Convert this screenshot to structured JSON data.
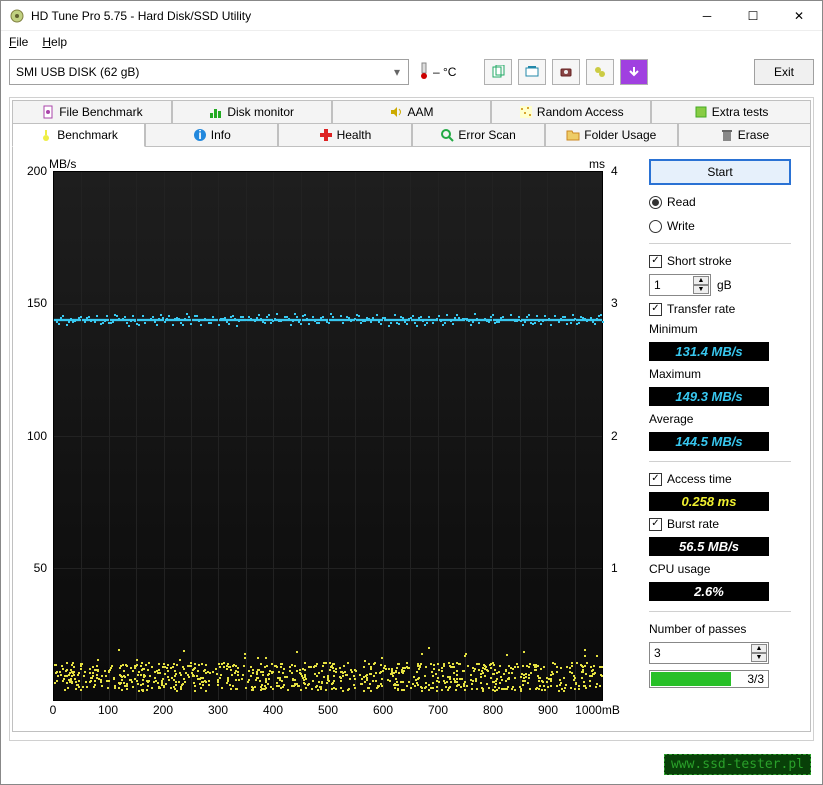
{
  "window": {
    "title": "HD Tune Pro 5.75 - Hard Disk/SSD Utility"
  },
  "menu": {
    "file": "File",
    "help": "Help"
  },
  "toolbar": {
    "drive": "SMI    USB DISK (62 gB)",
    "temp": "– °C",
    "exit": "Exit"
  },
  "tabs_row1": [
    "File Benchmark",
    "Disk monitor",
    "AAM",
    "Random Access",
    "Extra tests"
  ],
  "tabs_row2": [
    "Benchmark",
    "Info",
    "Health",
    "Error Scan",
    "Folder Usage",
    "Erase"
  ],
  "active_tab": "Benchmark",
  "chart_data": {
    "type": "line",
    "xlabel": "mB",
    "ylabel_left": "MB/s",
    "ylabel_right": "ms",
    "xlim": [
      0,
      1000
    ],
    "ylim_left": [
      0,
      200
    ],
    "y_ticks_left": [
      50,
      100,
      150,
      200
    ],
    "ylim_right": [
      0,
      4.0
    ],
    "y_ticks_right": [
      1.0,
      2.0,
      3.0,
      4.0
    ],
    "x_ticks": [
      0,
      100,
      200,
      300,
      400,
      500,
      600,
      700,
      800,
      900,
      1000
    ],
    "series": [
      {
        "name": "Transfer rate (MB/s)",
        "color": "#38c8f0",
        "approx_value": 144.5
      },
      {
        "name": "Access time (ms)",
        "color": "#e4e040",
        "approx_value": 0.258
      }
    ],
    "note": "Transfer rate is a roughly flat line near 144.5 MB/s across 0–1000 mB with small jitter; access-time scatter is a dense yellow band near the bottom (~0.2–0.4 ms equivalent)."
  },
  "panel": {
    "start": "Start",
    "read": "Read",
    "write": "Write",
    "short_stroke": "Short stroke",
    "short_stroke_val": "1",
    "short_stroke_unit": "gB",
    "transfer_rate": "Transfer rate",
    "minimum_label": "Minimum",
    "minimum_val": "131.4 MB/s",
    "maximum_label": "Maximum",
    "maximum_val": "149.3 MB/s",
    "average_label": "Average",
    "average_val": "144.5 MB/s",
    "access_time": "Access time",
    "access_val": "0.258 ms",
    "burst_rate": "Burst rate",
    "burst_val": "56.5 MB/s",
    "cpu_label": "CPU usage",
    "cpu_val": "2.6%",
    "passes_label": "Number of passes",
    "passes_val": "3",
    "passes_progress": "3/3"
  },
  "watermark": "www.ssd-tester.pl"
}
